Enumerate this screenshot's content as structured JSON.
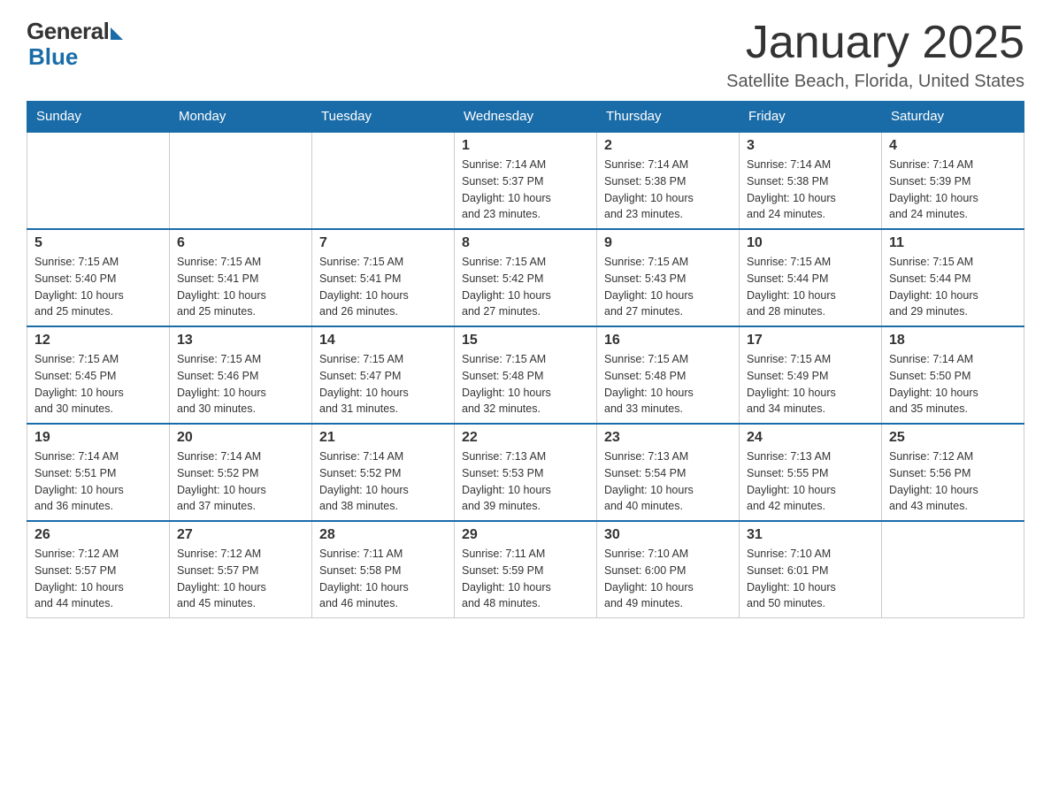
{
  "logo": {
    "general": "General",
    "blue": "Blue"
  },
  "title": "January 2025",
  "location": "Satellite Beach, Florida, United States",
  "weekdays": [
    "Sunday",
    "Monday",
    "Tuesday",
    "Wednesday",
    "Thursday",
    "Friday",
    "Saturday"
  ],
  "weeks": [
    [
      {
        "day": "",
        "info": ""
      },
      {
        "day": "",
        "info": ""
      },
      {
        "day": "",
        "info": ""
      },
      {
        "day": "1",
        "info": "Sunrise: 7:14 AM\nSunset: 5:37 PM\nDaylight: 10 hours\nand 23 minutes."
      },
      {
        "day": "2",
        "info": "Sunrise: 7:14 AM\nSunset: 5:38 PM\nDaylight: 10 hours\nand 23 minutes."
      },
      {
        "day": "3",
        "info": "Sunrise: 7:14 AM\nSunset: 5:38 PM\nDaylight: 10 hours\nand 24 minutes."
      },
      {
        "day": "4",
        "info": "Sunrise: 7:14 AM\nSunset: 5:39 PM\nDaylight: 10 hours\nand 24 minutes."
      }
    ],
    [
      {
        "day": "5",
        "info": "Sunrise: 7:15 AM\nSunset: 5:40 PM\nDaylight: 10 hours\nand 25 minutes."
      },
      {
        "day": "6",
        "info": "Sunrise: 7:15 AM\nSunset: 5:41 PM\nDaylight: 10 hours\nand 25 minutes."
      },
      {
        "day": "7",
        "info": "Sunrise: 7:15 AM\nSunset: 5:41 PM\nDaylight: 10 hours\nand 26 minutes."
      },
      {
        "day": "8",
        "info": "Sunrise: 7:15 AM\nSunset: 5:42 PM\nDaylight: 10 hours\nand 27 minutes."
      },
      {
        "day": "9",
        "info": "Sunrise: 7:15 AM\nSunset: 5:43 PM\nDaylight: 10 hours\nand 27 minutes."
      },
      {
        "day": "10",
        "info": "Sunrise: 7:15 AM\nSunset: 5:44 PM\nDaylight: 10 hours\nand 28 minutes."
      },
      {
        "day": "11",
        "info": "Sunrise: 7:15 AM\nSunset: 5:44 PM\nDaylight: 10 hours\nand 29 minutes."
      }
    ],
    [
      {
        "day": "12",
        "info": "Sunrise: 7:15 AM\nSunset: 5:45 PM\nDaylight: 10 hours\nand 30 minutes."
      },
      {
        "day": "13",
        "info": "Sunrise: 7:15 AM\nSunset: 5:46 PM\nDaylight: 10 hours\nand 30 minutes."
      },
      {
        "day": "14",
        "info": "Sunrise: 7:15 AM\nSunset: 5:47 PM\nDaylight: 10 hours\nand 31 minutes."
      },
      {
        "day": "15",
        "info": "Sunrise: 7:15 AM\nSunset: 5:48 PM\nDaylight: 10 hours\nand 32 minutes."
      },
      {
        "day": "16",
        "info": "Sunrise: 7:15 AM\nSunset: 5:48 PM\nDaylight: 10 hours\nand 33 minutes."
      },
      {
        "day": "17",
        "info": "Sunrise: 7:15 AM\nSunset: 5:49 PM\nDaylight: 10 hours\nand 34 minutes."
      },
      {
        "day": "18",
        "info": "Sunrise: 7:14 AM\nSunset: 5:50 PM\nDaylight: 10 hours\nand 35 minutes."
      }
    ],
    [
      {
        "day": "19",
        "info": "Sunrise: 7:14 AM\nSunset: 5:51 PM\nDaylight: 10 hours\nand 36 minutes."
      },
      {
        "day": "20",
        "info": "Sunrise: 7:14 AM\nSunset: 5:52 PM\nDaylight: 10 hours\nand 37 minutes."
      },
      {
        "day": "21",
        "info": "Sunrise: 7:14 AM\nSunset: 5:52 PM\nDaylight: 10 hours\nand 38 minutes."
      },
      {
        "day": "22",
        "info": "Sunrise: 7:13 AM\nSunset: 5:53 PM\nDaylight: 10 hours\nand 39 minutes."
      },
      {
        "day": "23",
        "info": "Sunrise: 7:13 AM\nSunset: 5:54 PM\nDaylight: 10 hours\nand 40 minutes."
      },
      {
        "day": "24",
        "info": "Sunrise: 7:13 AM\nSunset: 5:55 PM\nDaylight: 10 hours\nand 42 minutes."
      },
      {
        "day": "25",
        "info": "Sunrise: 7:12 AM\nSunset: 5:56 PM\nDaylight: 10 hours\nand 43 minutes."
      }
    ],
    [
      {
        "day": "26",
        "info": "Sunrise: 7:12 AM\nSunset: 5:57 PM\nDaylight: 10 hours\nand 44 minutes."
      },
      {
        "day": "27",
        "info": "Sunrise: 7:12 AM\nSunset: 5:57 PM\nDaylight: 10 hours\nand 45 minutes."
      },
      {
        "day": "28",
        "info": "Sunrise: 7:11 AM\nSunset: 5:58 PM\nDaylight: 10 hours\nand 46 minutes."
      },
      {
        "day": "29",
        "info": "Sunrise: 7:11 AM\nSunset: 5:59 PM\nDaylight: 10 hours\nand 48 minutes."
      },
      {
        "day": "30",
        "info": "Sunrise: 7:10 AM\nSunset: 6:00 PM\nDaylight: 10 hours\nand 49 minutes."
      },
      {
        "day": "31",
        "info": "Sunrise: 7:10 AM\nSunset: 6:01 PM\nDaylight: 10 hours\nand 50 minutes."
      },
      {
        "day": "",
        "info": ""
      }
    ]
  ]
}
